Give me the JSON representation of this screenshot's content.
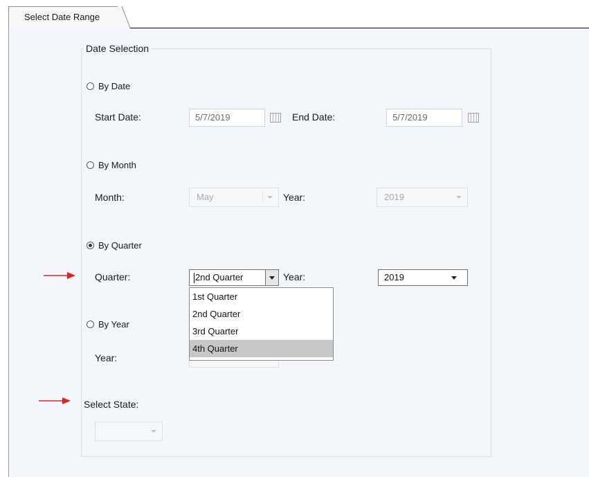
{
  "tab": {
    "label": "Select Date Range"
  },
  "group": {
    "title": "Date Selection"
  },
  "by_date": {
    "radio_label": "By Date",
    "start_label": "Start Date:",
    "start_value": "5/7/2019",
    "end_label": "End Date:",
    "end_value": "5/7/2019"
  },
  "by_month": {
    "radio_label": "By Month",
    "month_label": "Month:",
    "month_value": "May",
    "year_label": "Year:",
    "year_value": "2019"
  },
  "by_quarter": {
    "radio_label": "By Quarter",
    "quarter_label": "Quarter:",
    "quarter_value": "2nd Quarter",
    "year_label": "Year:",
    "year_value": "2019",
    "options": [
      "1st Quarter",
      "2nd Quarter",
      "3rd Quarter",
      "4th Quarter"
    ]
  },
  "by_year": {
    "radio_label": "By Year",
    "year_label": "Year:"
  },
  "state": {
    "label": "Select State:"
  },
  "colors": {
    "annotation_arrow": "#e8201a",
    "selection_highlight": "#c7c7c7"
  }
}
